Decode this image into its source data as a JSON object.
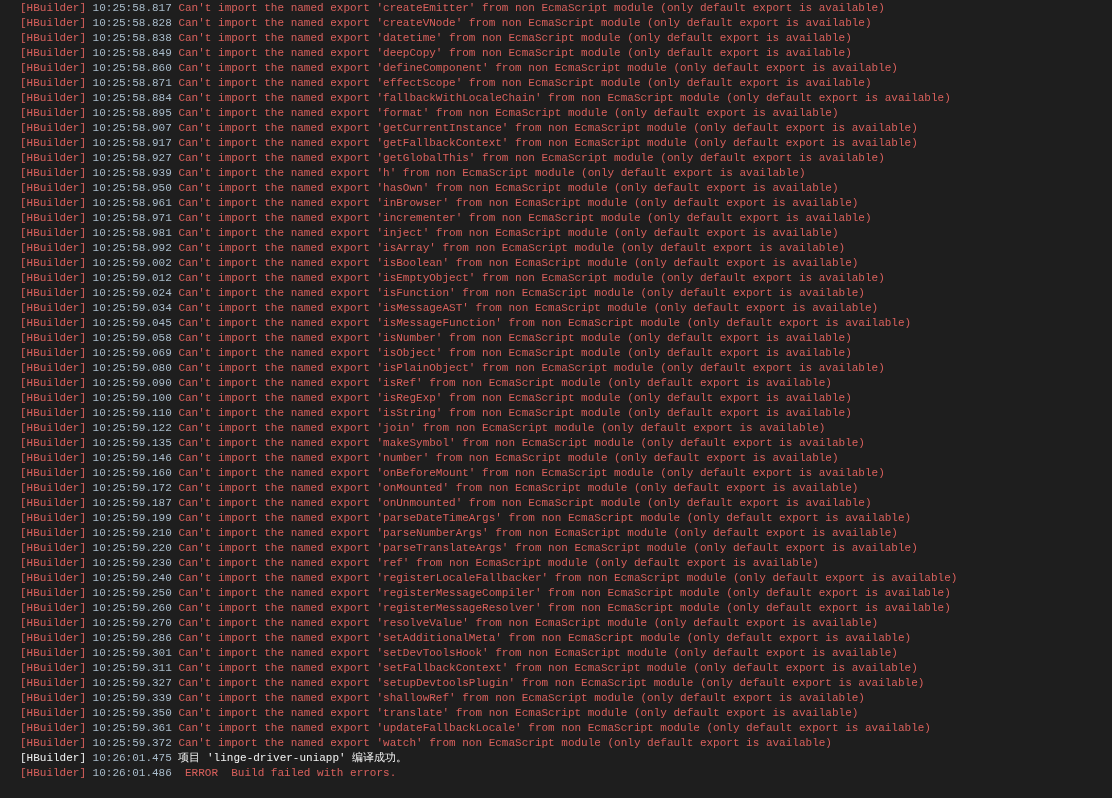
{
  "console": {
    "lines": [
      {
        "kind": "error",
        "source": "[HBuilder]",
        "time": "10:25:58.817",
        "message": "Can't import the named export 'createEmitter' from non EcmaScript module (only default export is available)"
      },
      {
        "kind": "error",
        "source": "[HBuilder]",
        "time": "10:25:58.828",
        "message": "Can't import the named export 'createVNode' from non EcmaScript module (only default export is available)"
      },
      {
        "kind": "error",
        "source": "[HBuilder]",
        "time": "10:25:58.838",
        "message": "Can't import the named export 'datetime' from non EcmaScript module (only default export is available)"
      },
      {
        "kind": "error",
        "source": "[HBuilder]",
        "time": "10:25:58.849",
        "message": "Can't import the named export 'deepCopy' from non EcmaScript module (only default export is available)"
      },
      {
        "kind": "error",
        "source": "[HBuilder]",
        "time": "10:25:58.860",
        "message": "Can't import the named export 'defineComponent' from non EcmaScript module (only default export is available)"
      },
      {
        "kind": "error",
        "source": "[HBuilder]",
        "time": "10:25:58.871",
        "message": "Can't import the named export 'effectScope' from non EcmaScript module (only default export is available)"
      },
      {
        "kind": "error",
        "source": "[HBuilder]",
        "time": "10:25:58.884",
        "message": "Can't import the named export 'fallbackWithLocaleChain' from non EcmaScript module (only default export is available)"
      },
      {
        "kind": "error",
        "source": "[HBuilder]",
        "time": "10:25:58.895",
        "message": "Can't import the named export 'format' from non EcmaScript module (only default export is available)"
      },
      {
        "kind": "error",
        "source": "[HBuilder]",
        "time": "10:25:58.907",
        "message": "Can't import the named export 'getCurrentInstance' from non EcmaScript module (only default export is available)"
      },
      {
        "kind": "error",
        "source": "[HBuilder]",
        "time": "10:25:58.917",
        "message": "Can't import the named export 'getFallbackContext' from non EcmaScript module (only default export is available)"
      },
      {
        "kind": "error",
        "source": "[HBuilder]",
        "time": "10:25:58.927",
        "message": "Can't import the named export 'getGlobalThis' from non EcmaScript module (only default export is available)"
      },
      {
        "kind": "error",
        "source": "[HBuilder]",
        "time": "10:25:58.939",
        "message": "Can't import the named export 'h' from non EcmaScript module (only default export is available)"
      },
      {
        "kind": "error",
        "source": "[HBuilder]",
        "time": "10:25:58.950",
        "message": "Can't import the named export 'hasOwn' from non EcmaScript module (only default export is available)"
      },
      {
        "kind": "error",
        "source": "[HBuilder]",
        "time": "10:25:58.961",
        "message": "Can't import the named export 'inBrowser' from non EcmaScript module (only default export is available)"
      },
      {
        "kind": "error",
        "source": "[HBuilder]",
        "time": "10:25:58.971",
        "message": "Can't import the named export 'incrementer' from non EcmaScript module (only default export is available)"
      },
      {
        "kind": "error",
        "source": "[HBuilder]",
        "time": "10:25:58.981",
        "message": "Can't import the named export 'inject' from non EcmaScript module (only default export is available)"
      },
      {
        "kind": "error",
        "source": "[HBuilder]",
        "time": "10:25:58.992",
        "message": "Can't import the named export 'isArray' from non EcmaScript module (only default export is available)"
      },
      {
        "kind": "error",
        "source": "[HBuilder]",
        "time": "10:25:59.002",
        "message": "Can't import the named export 'isBoolean' from non EcmaScript module (only default export is available)"
      },
      {
        "kind": "error",
        "source": "[HBuilder]",
        "time": "10:25:59.012",
        "message": "Can't import the named export 'isEmptyObject' from non EcmaScript module (only default export is available)"
      },
      {
        "kind": "error",
        "source": "[HBuilder]",
        "time": "10:25:59.024",
        "message": "Can't import the named export 'isFunction' from non EcmaScript module (only default export is available)"
      },
      {
        "kind": "error",
        "source": "[HBuilder]",
        "time": "10:25:59.034",
        "message": "Can't import the named export 'isMessageAST' from non EcmaScript module (only default export is available)"
      },
      {
        "kind": "error",
        "source": "[HBuilder]",
        "time": "10:25:59.045",
        "message": "Can't import the named export 'isMessageFunction' from non EcmaScript module (only default export is available)"
      },
      {
        "kind": "error",
        "source": "[HBuilder]",
        "time": "10:25:59.058",
        "message": "Can't import the named export 'isNumber' from non EcmaScript module (only default export is available)"
      },
      {
        "kind": "error",
        "source": "[HBuilder]",
        "time": "10:25:59.069",
        "message": "Can't import the named export 'isObject' from non EcmaScript module (only default export is available)"
      },
      {
        "kind": "error",
        "source": "[HBuilder]",
        "time": "10:25:59.080",
        "message": "Can't import the named export 'isPlainObject' from non EcmaScript module (only default export is available)"
      },
      {
        "kind": "error",
        "source": "[HBuilder]",
        "time": "10:25:59.090",
        "message": "Can't import the named export 'isRef' from non EcmaScript module (only default export is available)"
      },
      {
        "kind": "error",
        "source": "[HBuilder]",
        "time": "10:25:59.100",
        "message": "Can't import the named export 'isRegExp' from non EcmaScript module (only default export is available)"
      },
      {
        "kind": "error",
        "source": "[HBuilder]",
        "time": "10:25:59.110",
        "message": "Can't import the named export 'isString' from non EcmaScript module (only default export is available)"
      },
      {
        "kind": "error",
        "source": "[HBuilder]",
        "time": "10:25:59.122",
        "message": "Can't import the named export 'join' from non EcmaScript module (only default export is available)"
      },
      {
        "kind": "error",
        "source": "[HBuilder]",
        "time": "10:25:59.135",
        "message": "Can't import the named export 'makeSymbol' from non EcmaScript module (only default export is available)"
      },
      {
        "kind": "error",
        "source": "[HBuilder]",
        "time": "10:25:59.146",
        "message": "Can't import the named export 'number' from non EcmaScript module (only default export is available)"
      },
      {
        "kind": "error",
        "source": "[HBuilder]",
        "time": "10:25:59.160",
        "message": "Can't import the named export 'onBeforeMount' from non EcmaScript module (only default export is available)"
      },
      {
        "kind": "error",
        "source": "[HBuilder]",
        "time": "10:25:59.172",
        "message": "Can't import the named export 'onMounted' from non EcmaScript module (only default export is available)"
      },
      {
        "kind": "error",
        "source": "[HBuilder]",
        "time": "10:25:59.187",
        "message": "Can't import the named export 'onUnmounted' from non EcmaScript module (only default export is available)"
      },
      {
        "kind": "error",
        "source": "[HBuilder]",
        "time": "10:25:59.199",
        "message": "Can't import the named export 'parseDateTimeArgs' from non EcmaScript module (only default export is available)"
      },
      {
        "kind": "error",
        "source": "[HBuilder]",
        "time": "10:25:59.210",
        "message": "Can't import the named export 'parseNumberArgs' from non EcmaScript module (only default export is available)"
      },
      {
        "kind": "error",
        "source": "[HBuilder]",
        "time": "10:25:59.220",
        "message": "Can't import the named export 'parseTranslateArgs' from non EcmaScript module (only default export is available)"
      },
      {
        "kind": "error",
        "source": "[HBuilder]",
        "time": "10:25:59.230",
        "message": "Can't import the named export 'ref' from non EcmaScript module (only default export is available)"
      },
      {
        "kind": "error",
        "source": "[HBuilder]",
        "time": "10:25:59.240",
        "message": "Can't import the named export 'registerLocaleFallbacker' from non EcmaScript module (only default export is available)"
      },
      {
        "kind": "error",
        "source": "[HBuilder]",
        "time": "10:25:59.250",
        "message": "Can't import the named export 'registerMessageCompiler' from non EcmaScript module (only default export is available)"
      },
      {
        "kind": "error",
        "source": "[HBuilder]",
        "time": "10:25:59.260",
        "message": "Can't import the named export 'registerMessageResolver' from non EcmaScript module (only default export is available)"
      },
      {
        "kind": "error",
        "source": "[HBuilder]",
        "time": "10:25:59.270",
        "message": "Can't import the named export 'resolveValue' from non EcmaScript module (only default export is available)"
      },
      {
        "kind": "error",
        "source": "[HBuilder]",
        "time": "10:25:59.286",
        "message": "Can't import the named export 'setAdditionalMeta' from non EcmaScript module (only default export is available)"
      },
      {
        "kind": "error",
        "source": "[HBuilder]",
        "time": "10:25:59.301",
        "message": "Can't import the named export 'setDevToolsHook' from non EcmaScript module (only default export is available)"
      },
      {
        "kind": "error",
        "source": "[HBuilder]",
        "time": "10:25:59.311",
        "message": "Can't import the named export 'setFallbackContext' from non EcmaScript module (only default export is available)"
      },
      {
        "kind": "error",
        "source": "[HBuilder]",
        "time": "10:25:59.327",
        "message": "Can't import the named export 'setupDevtoolsPlugin' from non EcmaScript module (only default export is available)"
      },
      {
        "kind": "error",
        "source": "[HBuilder]",
        "time": "10:25:59.339",
        "message": "Can't import the named export 'shallowRef' from non EcmaScript module (only default export is available)"
      },
      {
        "kind": "error",
        "source": "[HBuilder]",
        "time": "10:25:59.350",
        "message": "Can't import the named export 'translate' from non EcmaScript module (only default export is available)"
      },
      {
        "kind": "error",
        "source": "[HBuilder]",
        "time": "10:25:59.361",
        "message": "Can't import the named export 'updateFallbackLocale' from non EcmaScript module (only default export is available)"
      },
      {
        "kind": "error",
        "source": "[HBuilder]",
        "time": "10:25:59.372",
        "message": "Can't import the named export 'watch' from non EcmaScript module (only default export is available)"
      },
      {
        "kind": "info",
        "source": "[HBuilder]",
        "time": "10:26:01.475",
        "message": "项目 'linge-driver-uniapp' 编译成功。"
      },
      {
        "kind": "error",
        "source": "[HBuilder]",
        "time": "10:26:01.486",
        "message": " ERROR  Build failed with errors."
      }
    ]
  }
}
